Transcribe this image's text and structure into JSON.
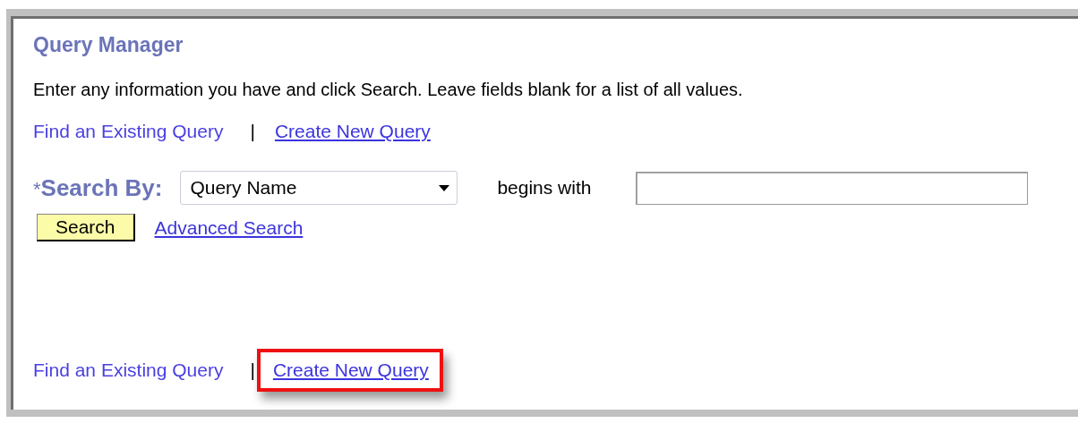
{
  "title": "Query Manager",
  "instructions": "Enter any information you have and click Search. Leave fields blank for a list of all values.",
  "top_nav": [
    {
      "label": "Find an Existing Query",
      "selected": true
    },
    {
      "label": "Create New Query",
      "selected": false
    }
  ],
  "nav_separator": "|",
  "search": {
    "required_mark": "*",
    "label": "Search By:",
    "field_value": "Query Name",
    "operator": "begins with",
    "button": "Search",
    "advanced_link": "Advanced Search"
  },
  "bottom_nav": [
    {
      "label": "Find an Existing Query",
      "selected": true,
      "highlighted": false
    },
    {
      "label": "Create New Query",
      "selected": false,
      "highlighted": true
    }
  ]
}
